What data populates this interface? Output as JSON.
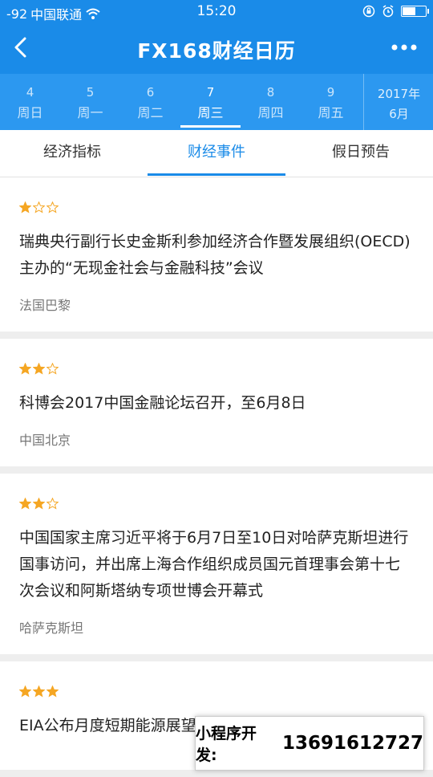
{
  "status_bar": {
    "signal": "-92",
    "carrier": "中国联通",
    "time": "15:20"
  },
  "navbar": {
    "title": "FX168财经日历",
    "back_icon": "chevron-left-icon",
    "more_icon": "more-dots-icon"
  },
  "date_strip": {
    "days": [
      {
        "num": "4",
        "weekday": "周日"
      },
      {
        "num": "5",
        "weekday": "周一"
      },
      {
        "num": "6",
        "weekday": "周二"
      },
      {
        "num": "7",
        "weekday": "周三"
      },
      {
        "num": "8",
        "weekday": "周四"
      },
      {
        "num": "9",
        "weekday": "周五"
      }
    ],
    "active_index": 3,
    "year": "2017年",
    "month": "6月"
  },
  "tabs": [
    {
      "label": "经济指标"
    },
    {
      "label": "财经事件"
    },
    {
      "label": "假日预告"
    }
  ],
  "events": [
    {
      "stars": 1,
      "title": "瑞典央行副行长史金斯利参加经济合作暨发展组织(OECD)主办的“无现金社会与金融科技”会议",
      "location": "法国巴黎"
    },
    {
      "stars": 2,
      "title": "科博会2017中国金融论坛召开，至6月8日",
      "location": "中国北京"
    },
    {
      "stars": 2,
      "title": "中国国家主席习近平将于6月7日至10日对哈萨克斯坦进行国事访问，并出席上海合作组织成员国元首理事会第十七次会议和阿斯塔纳专项世博会开幕式",
      "location": "哈萨克斯坦"
    },
    {
      "stars": 3,
      "title": "EIA公布月度短期能源展望报告",
      "location": ""
    }
  ],
  "promo": {
    "label": "小程序开发:",
    "phone": "13691612727"
  },
  "colors": {
    "primary": "#1a8be8",
    "star": "#f5a623"
  }
}
